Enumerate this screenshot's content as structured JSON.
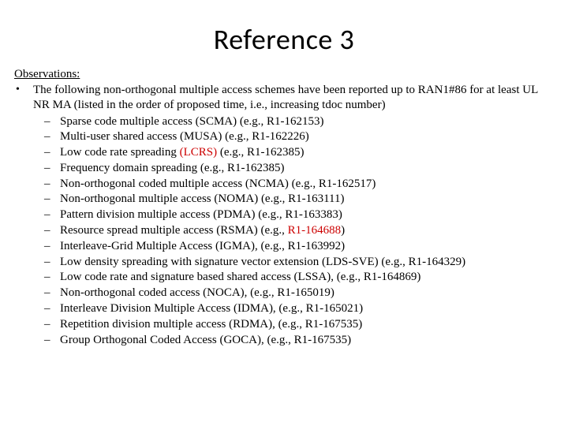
{
  "title": "Reference 3",
  "heading": "Observations:",
  "bullet": {
    "dot": "•",
    "text": "The following non-orthogonal multiple access schemes have been reported up to RAN1#86 for at least UL NR MA (listed in the order of proposed time, i.e., increasing tdoc number)"
  },
  "dash": "–",
  "items": [
    {
      "pre": "Sparse code multiple access (SCMA) (e.g., R1-162153)",
      "red": "",
      "post": ""
    },
    {
      "pre": "Multi-user shared access (MUSA) (e.g., R1-162226)",
      "red": "",
      "post": ""
    },
    {
      "pre": "Low code rate spreading ",
      "red": "(LCRS)",
      "post": " (e.g., R1-162385)"
    },
    {
      "pre": "Frequency domain spreading (e.g., R1-162385)",
      "red": "",
      "post": ""
    },
    {
      "pre": "Non-orthogonal coded multiple access (NCMA) (e.g., R1-162517)",
      "red": "",
      "post": ""
    },
    {
      "pre": "Non-orthogonal multiple access (NOMA) (e.g., R1-163111)",
      "red": "",
      "post": ""
    },
    {
      "pre": "Pattern division multiple access (PDMA) (e.g., R1-163383)",
      "red": "",
      "post": ""
    },
    {
      "pre": "Resource spread multiple access (RSMA) (e.g., ",
      "red": "R1-164688",
      "post": ")"
    },
    {
      "pre": "Interleave-Grid Multiple Access (IGMA), (e.g., R1-163992)",
      "red": "",
      "post": ""
    },
    {
      "pre": "Low density spreading with signature vector extension (LDS-SVE) (e.g., R1-164329)",
      "red": "",
      "post": ""
    },
    {
      "pre": "Low code rate and signature based shared access (LSSA), (e.g., R1-164869)",
      "red": "",
      "post": ""
    },
    {
      "pre": "Non-orthogonal coded access (NOCA), (e.g., R1-165019)",
      "red": "",
      "post": ""
    },
    {
      "pre": "Interleave Division Multiple Access (IDMA), (e.g., R1-165021)",
      "red": "",
      "post": ""
    },
    {
      "pre": "Repetition division multiple access (RDMA), (e.g., R1-167535)",
      "red": "",
      "post": ""
    },
    {
      "pre": "Group Orthogonal Coded Access (GOCA), (e.g., R1-167535)",
      "red": "",
      "post": ""
    }
  ]
}
